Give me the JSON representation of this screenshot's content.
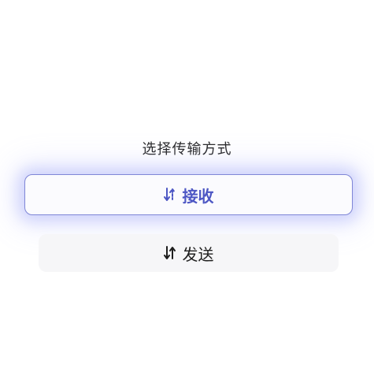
{
  "dialog": {
    "prompt": "选择传输方式",
    "receive": {
      "label": "接收",
      "icon": "sort-arrows-icon",
      "color": "#4d57c4"
    },
    "send": {
      "label": "发送",
      "icon": "sort-arrows-icon",
      "color": "#1e1e1e"
    }
  },
  "colors": {
    "accent": "#4d57c4",
    "accent_border": "#7f86d6",
    "secondary_bg": "#f6f6f8"
  }
}
